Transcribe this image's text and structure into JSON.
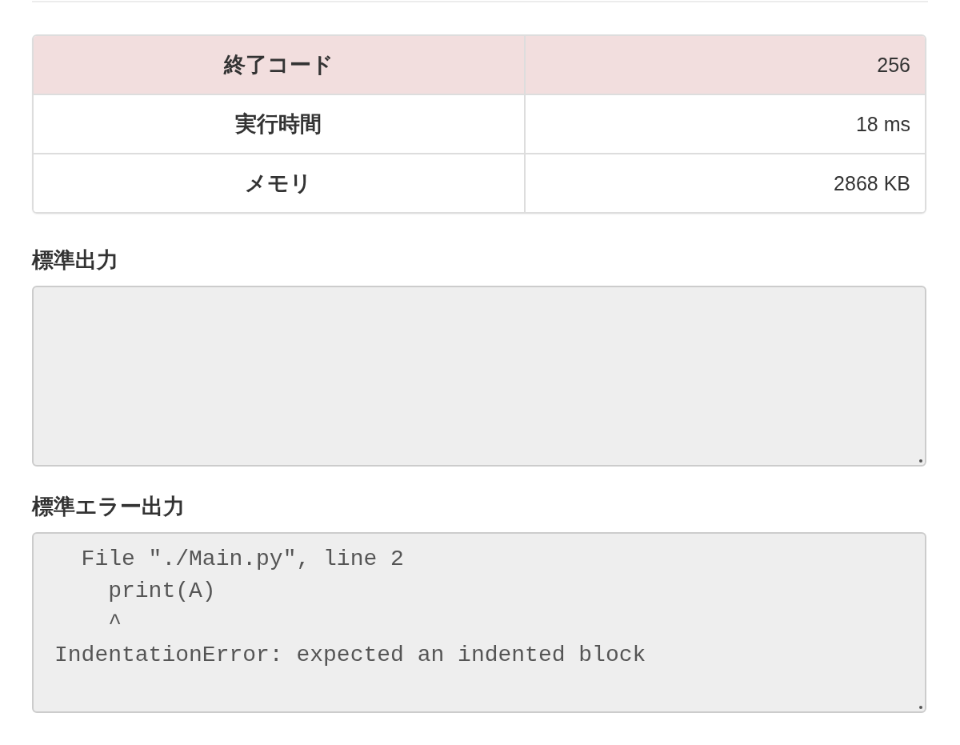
{
  "result_table": {
    "rows": [
      {
        "label": "終了コード",
        "value": "256",
        "highlighted": true
      },
      {
        "label": "実行時間",
        "value": "18 ms",
        "highlighted": false
      },
      {
        "label": "メモリ",
        "value": "2868 KB",
        "highlighted": false
      }
    ]
  },
  "outputs": [
    {
      "heading": "標準出力"
    },
    {
      "heading": "標準エラー出力",
      "lines": [
        "  File \"./Main.py\", line 2",
        "    print(A)",
        "    ^",
        "IndentationError: expected an indented block"
      ]
    }
  ]
}
